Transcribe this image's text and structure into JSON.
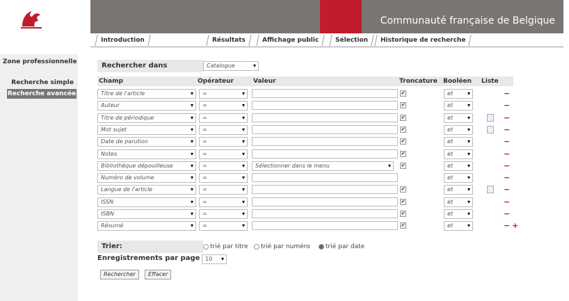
{
  "header": {
    "title": "Communauté française de Belgique"
  },
  "tabs": [
    "Introduction",
    "Résultats",
    "Affichage public",
    "Sélection",
    "Historique de recherche"
  ],
  "sidebar": {
    "title": "Zone professionnelle",
    "items": [
      "Recherche simple",
      "Recherche avancée"
    ]
  },
  "search": {
    "label": "Rechercher dans",
    "value": "Catalogue"
  },
  "table": {
    "headers": [
      "Champ",
      "Opérateur",
      "Valeur",
      "Troncature",
      "Booléen",
      "Liste"
    ],
    "rows": [
      {
        "field": "Titre de l'article",
        "op": "=",
        "value": "",
        "trunc": true,
        "bool": "et",
        "list": false
      },
      {
        "field": "Auteur",
        "op": "=",
        "value": "",
        "trunc": true,
        "bool": "et",
        "list": false
      },
      {
        "field": "Titre de périodique",
        "op": "=",
        "value": "",
        "trunc": true,
        "bool": "et",
        "list": true
      },
      {
        "field": "Mot sujet",
        "op": "=",
        "value": "",
        "trunc": true,
        "bool": "et",
        "list": true
      },
      {
        "field": "Date de parution",
        "op": "=",
        "value": "",
        "trunc": true,
        "bool": "et",
        "list": false
      },
      {
        "field": "Notes",
        "op": "=",
        "value": "",
        "trunc": true,
        "bool": "et",
        "list": false
      },
      {
        "field": "Bibliothèque dépouilleuse",
        "op": "=",
        "value": "Sélectionner dans le menu",
        "trunc": true,
        "bool": "et",
        "list": false
      },
      {
        "field": "Numéro de volume",
        "op": "=",
        "value": "",
        "trunc": false,
        "bool": "et",
        "list": false
      },
      {
        "field": "Langue de l'article",
        "op": "=",
        "value": "",
        "trunc": true,
        "bool": "et",
        "list": true
      },
      {
        "field": "ISSN",
        "op": "=",
        "value": "",
        "trunc": true,
        "bool": "et",
        "list": false
      },
      {
        "field": "ISBN",
        "op": "=",
        "value": "",
        "trunc": true,
        "bool": "et",
        "list": false
      },
      {
        "field": "Résumé",
        "op": "=",
        "value": "",
        "trunc": true,
        "bool": "et",
        "list": false
      }
    ]
  },
  "sort": {
    "label": "Trier:",
    "options": [
      "trié par titre",
      "trié par numéro",
      "trié par date"
    ],
    "selected": 2
  },
  "perpage": {
    "label": "Enregistrements par page",
    "value": "10"
  },
  "buttons": {
    "search": "Rechercher",
    "clear": "Effacer"
  },
  "colors": {
    "accent": "#c01c2c",
    "header_grey": "#7b7572"
  }
}
